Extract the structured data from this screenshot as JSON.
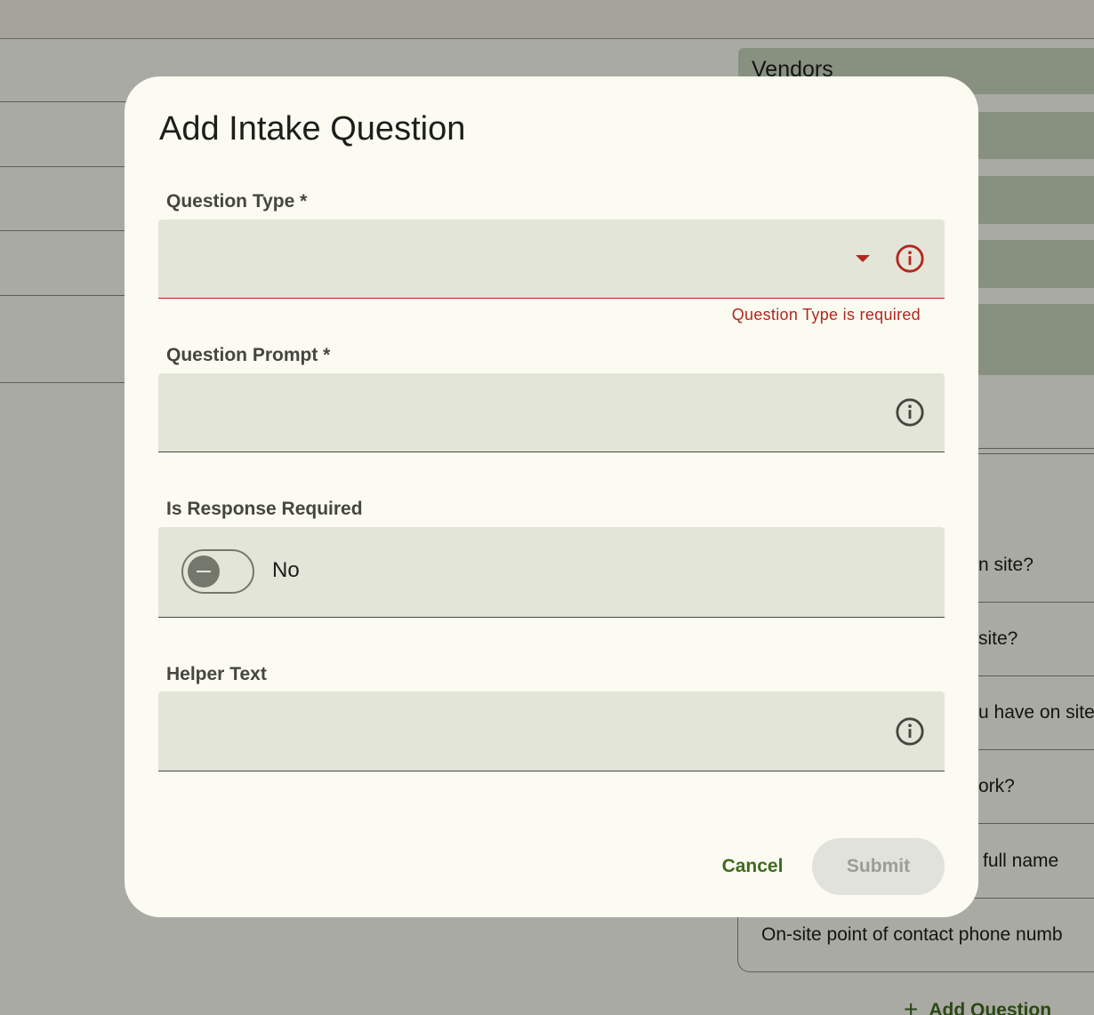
{
  "background": {
    "vendors_title": "Vendors",
    "questions": [
      "n site?",
      "site?",
      "u have on site",
      "ork?",
      "full name",
      "On-site point of contact phone numb"
    ],
    "add_question_label": "Add Question"
  },
  "dialog": {
    "title": "Add Intake Question",
    "question_type": {
      "label": "Question Type *",
      "value": "",
      "error": "Question Type is required"
    },
    "question_prompt": {
      "label": "Question Prompt *",
      "value": ""
    },
    "response_required": {
      "label": "Is Response Required",
      "value_label": "No",
      "checked": false
    },
    "helper_text": {
      "label": "Helper Text",
      "value": ""
    },
    "cancel_label": "Cancel",
    "submit_label": "Submit"
  },
  "colors": {
    "accent": "#3e6b1d",
    "error": "#b3261e",
    "field_bg": "#e3e5d8",
    "surface": "#fbfbf2"
  }
}
